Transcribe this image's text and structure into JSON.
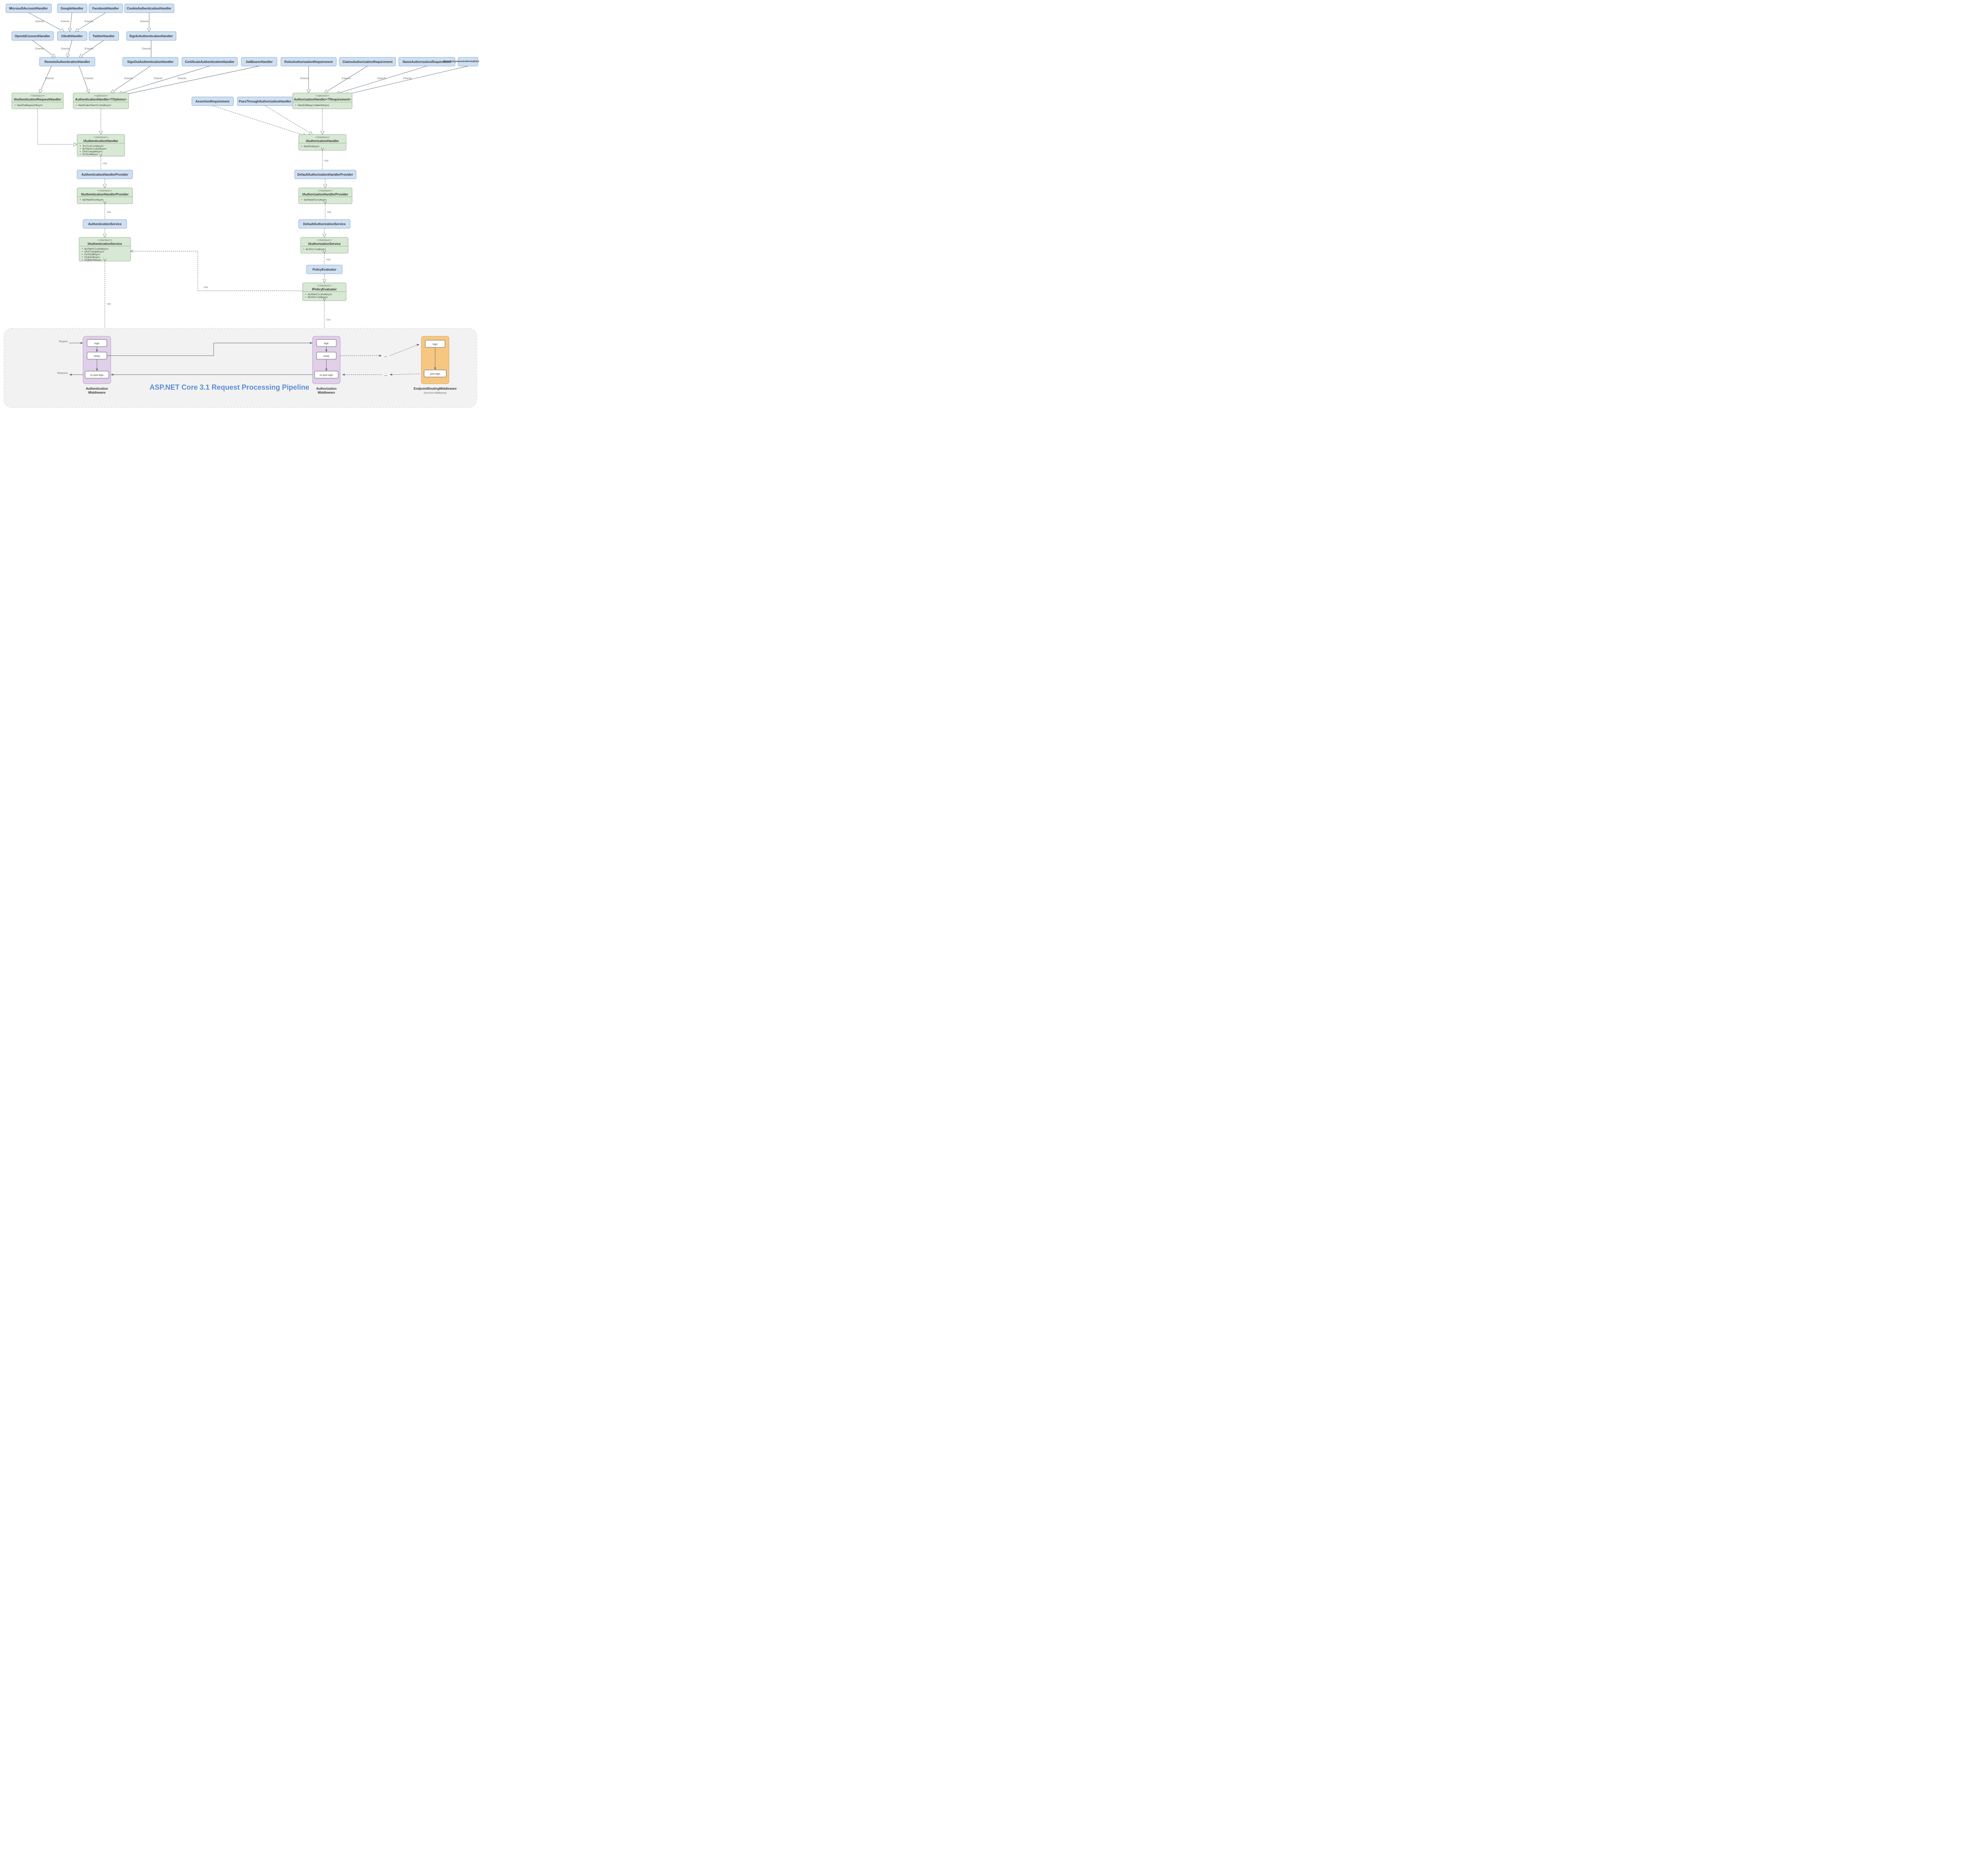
{
  "pipeline_title": "ASP.NET Core 3.1 Request Processing Pipeline",
  "top_handlers": {
    "row1": [
      "MicrosoftAccountHandler",
      "GoogleHandler",
      "FacebookHandler",
      "CookieAuthenticationHandler"
    ],
    "row2": [
      "OpenIdConnectHandler",
      "OAuthHandler",
      "TwitterHandler",
      "SignInAuthenticationHandler"
    ]
  },
  "remote_handler": "RemoteAuthenticationHandler",
  "mid_row": [
    "SignOutAuthenticationHandler",
    "CertificateAuthenticationHandler",
    "JwtBearerHandler",
    "RolesAuthorizationRequirement",
    "ClaimsAuthorizationRequirement",
    "NameAuthorizationRequirement",
    "DenyAnonymousAuthorizationRequirement"
  ],
  "iface_request_handler": {
    "stereo": "<<Interface>>",
    "name": "IAuthenticationRequestHandler",
    "methods": [
      "HandleRequestAsync"
    ]
  },
  "auth_handler_abs": {
    "stereo": "<<abstract>>",
    "name": "AuthenticationHandler<TOptions>",
    "methods": [
      "HandleAuthenticateAsync"
    ]
  },
  "assertion_req": "AssertionRequirement",
  "pass_through": "PassThroughAuthorizationHandler",
  "authz_handler_abs": {
    "stereo": "<<abstract>>",
    "name": "AuthorizationHandler<TRequirement>",
    "methods": [
      "HandleRequirementAsync"
    ]
  },
  "iauth_handler": {
    "stereo": "<<Interface>>",
    "name": "IAuthenticationHandler",
    "methods": [
      "InitializeAsync",
      "AuthenticateAsync",
      "ChallengeAsync",
      "ForbidAsync"
    ]
  },
  "iauthz_handler": {
    "stereo": "<<Interface>>",
    "name": "IAuthorizationHandler",
    "methods": [
      "HandleAsync"
    ]
  },
  "auth_provider": "AuthenticationHandlerProvider",
  "authz_provider": "DefaultAuthorizationHandlerProvider",
  "iauth_provider": {
    "stereo": "<<Interface>>",
    "name": "IAuthenticationHandlerProvider",
    "methods": [
      "GetHandlerAsync"
    ]
  },
  "iauthz_provider": {
    "stereo": "<<Interface>>",
    "name": "IAuthorizationHandlerProvider",
    "methods": [
      "GetHandlersAsync"
    ]
  },
  "auth_service": "AuthenticationService",
  "authz_service": "DefaultAuthorizationService",
  "iauth_service": {
    "stereo": "<<Interface>>",
    "name": "IAuthenticationService",
    "methods": [
      "AuthenticateAsync",
      "ChallengeAsync",
      "ForbidAsync",
      "SignInAsync",
      "SignOutAsync"
    ]
  },
  "iauthz_service": {
    "stereo": "<<Interface>>",
    "name": "IAuthorizationService",
    "methods": [
      "AuthorizeAsync"
    ]
  },
  "policy_eval": "PolicyEvaluator",
  "ipolicy_eval": {
    "stereo": "<<Interface>>",
    "name": "IPolicyEvaluator",
    "methods": [
      "AuthenticateAsync",
      "AuthorizeAsync"
    ]
  },
  "middleware": {
    "auth": "Authentication\nMiddleware",
    "authz": "Authorization\nMiddleware",
    "endpoint": "EndpointRoutingMiddleware",
    "endpoint_sub": "(terminal middleware)",
    "logic": "logic",
    "next": "next()",
    "nopost": "no post logic",
    "postlogic": "post logic",
    "request": "Request",
    "response": "Response",
    "dots": "..."
  },
  "labels": {
    "extends": "Extends",
    "use": "Use"
  }
}
